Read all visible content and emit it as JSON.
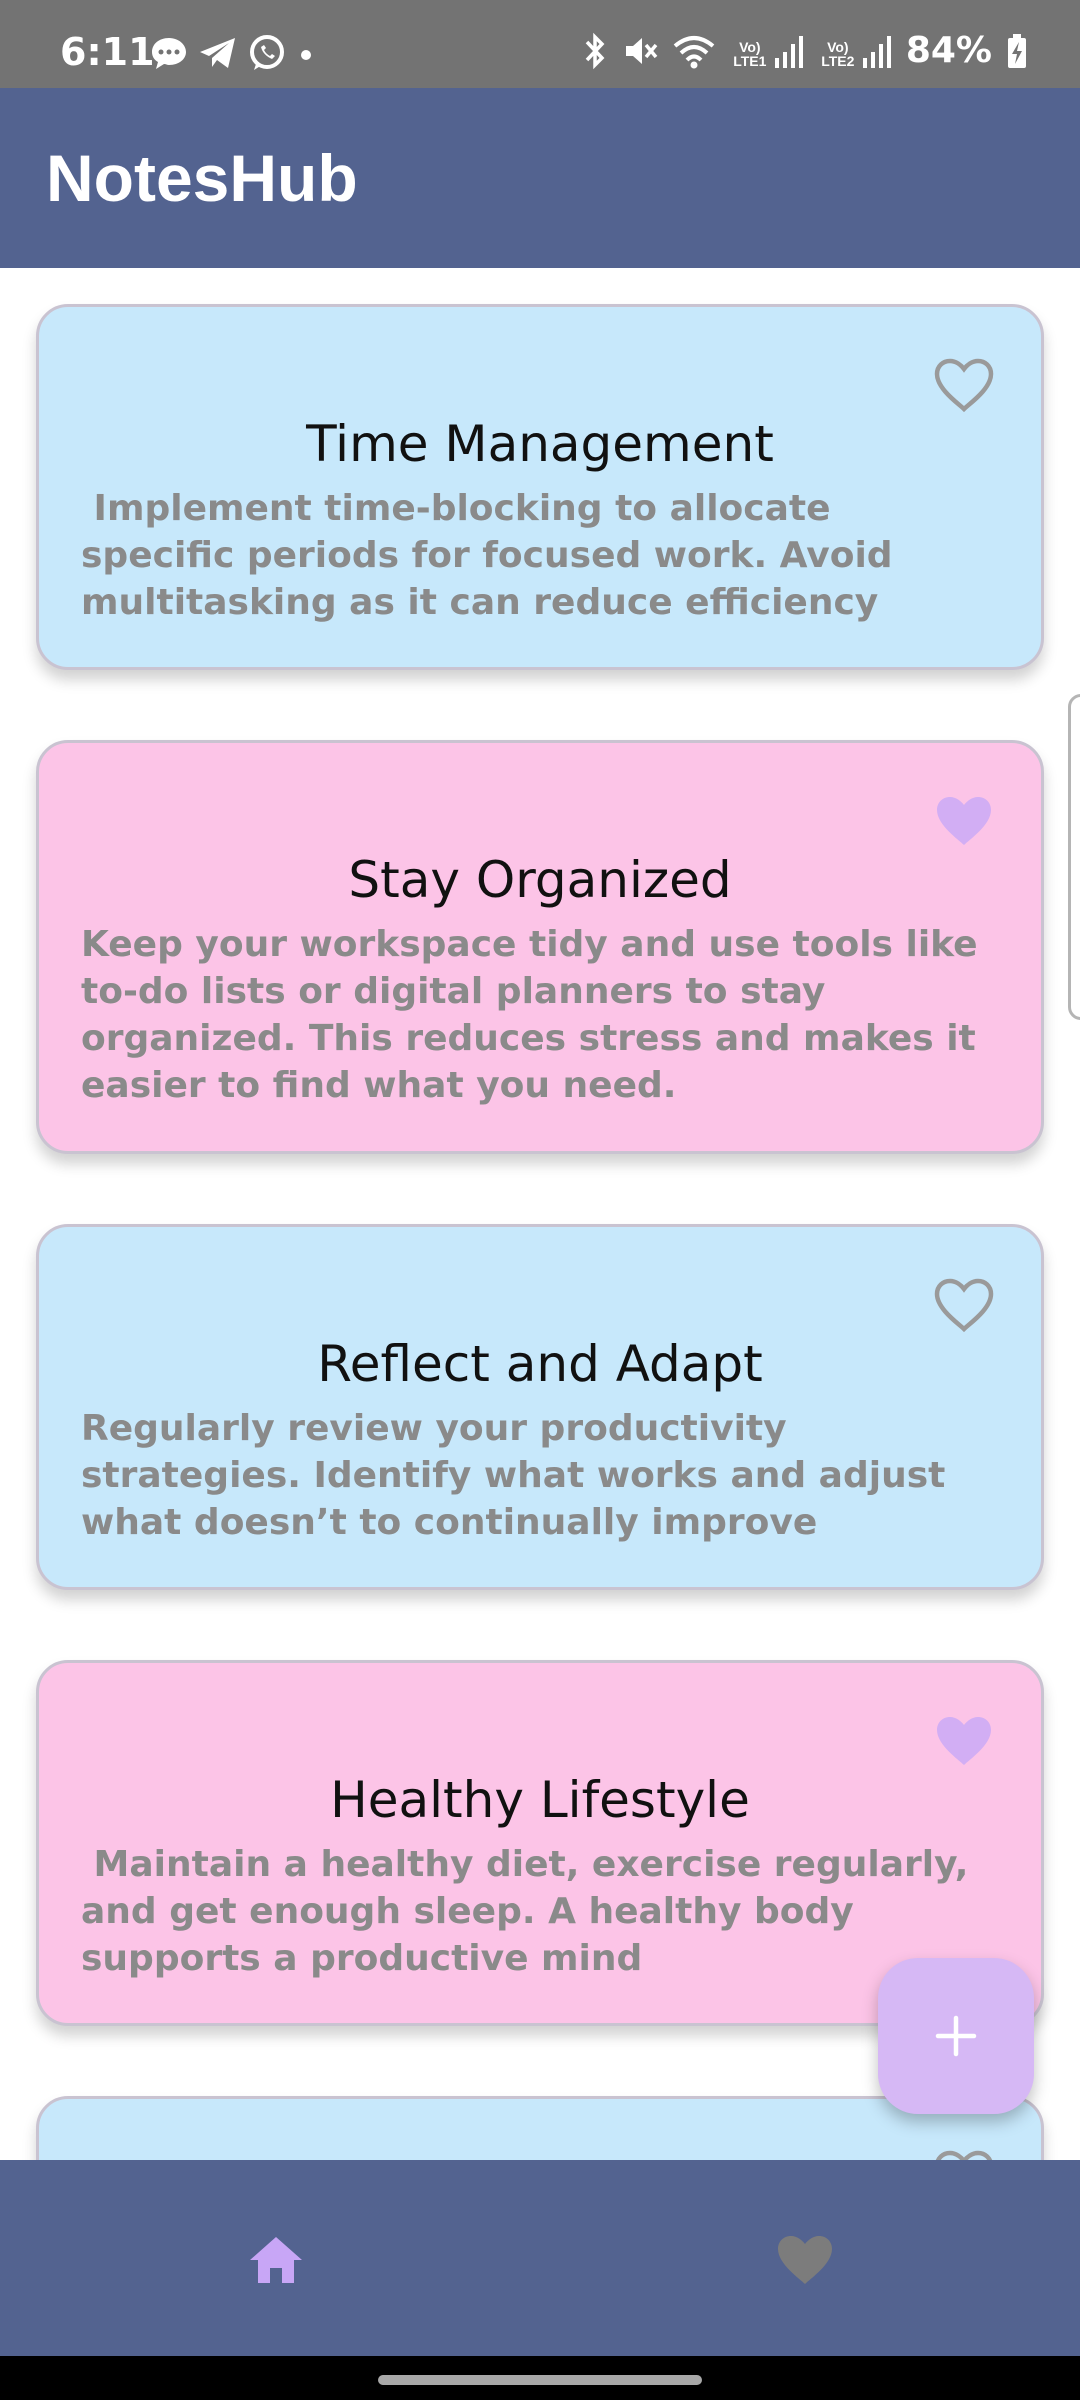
{
  "status_bar": {
    "time": "6:11",
    "battery": "84%",
    "left_icons": [
      "messages-icon",
      "telegram-icon",
      "whatsapp-icon",
      "dot-icon"
    ],
    "right_icons": [
      "bluetooth-icon",
      "mute-icon",
      "wifi-icon",
      "lte1-signal-icon",
      "lte2-signal-icon",
      "battery-charging-icon"
    ],
    "lte1_label": "Vo) LTE1",
    "lte2_label": "Vo) LTE2"
  },
  "app_bar": {
    "title": "NotesHub"
  },
  "notes": [
    {
      "title": "Time Management",
      "body": " Implement time-blocking to allocate specific periods for focused work. Avoid multitasking as it can reduce efficiency",
      "color": "blue",
      "favorite": false
    },
    {
      "title": "Stay Organized",
      "body": "Keep your workspace tidy and use tools like to-do lists or digital planners to stay organized. This reduces stress and makes it easier to find what you need.",
      "color": "pink",
      "favorite": true
    },
    {
      "title": "Reflect and Adapt",
      "body": "Regularly review your productivity strategies. Identify what works and adjust what doesn’t to continually improve",
      "color": "blue",
      "favorite": false
    },
    {
      "title": "Healthy Lifestyle",
      "body": " Maintain a healthy diet, exercise regularly, and get enough sleep. A healthy body supports a productive mind",
      "color": "pink",
      "favorite": true
    },
    {
      "title": "",
      "body": "",
      "color": "blue",
      "favorite": false
    }
  ],
  "fab": {
    "icon": "plus-icon"
  },
  "bottom_nav": {
    "items": [
      {
        "icon": "home-icon",
        "selected": true
      },
      {
        "icon": "heart-icon",
        "selected": false
      }
    ]
  },
  "colors": {
    "app_bar": "#536390",
    "card_blue": "#c7e8fb",
    "card_pink": "#fcc4e7",
    "favorite_on": "#d2aef4",
    "favorite_off": "#9a9a9a",
    "fab": "#d6b8f5"
  }
}
